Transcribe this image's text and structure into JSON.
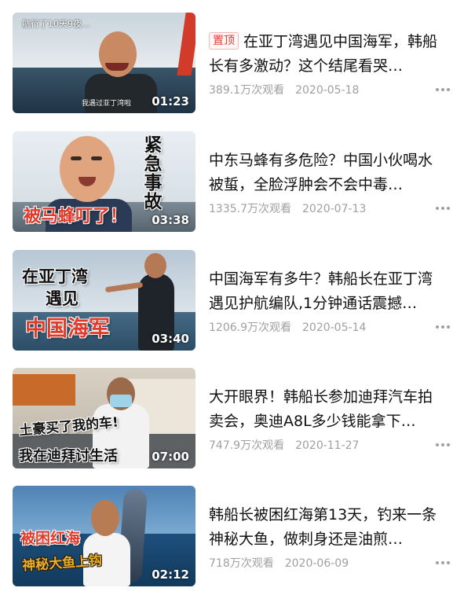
{
  "colors": {
    "pin": "#e33b3b",
    "meta": "#a0a0a0",
    "title": "#111111"
  },
  "videos": [
    {
      "pinned": true,
      "pin_label": "置顶",
      "title": "在亚丁湾遇见中国海军，韩船长有多激动？这个结尾看哭…",
      "views": "389.1万次观看",
      "date": "2020-05-18",
      "duration": "01:23",
      "thumb_top": "航行了10天9夜…",
      "thumb_caption": "我遇过亚丁湾啦"
    },
    {
      "pinned": false,
      "title": "中东马蜂有多危险？中国小伙喝水被蜇，全脸浮肿会不会中毒…",
      "views": "1335.7万次观看",
      "date": "2020-07-13",
      "duration": "03:38",
      "thumb_text_1": "被马蜂叮了！",
      "thumb_text_2": "紧急事故"
    },
    {
      "pinned": false,
      "title": "中国海军有多牛？韩船长在亚丁湾遇见护航编队,1分钟通话震撼…",
      "views": "1206.9万次观看",
      "date": "2020-05-14",
      "duration": "03:40",
      "thumb_text_1": "在亚丁湾",
      "thumb_text_2": "遇见",
      "thumb_text_3": "中国海军"
    },
    {
      "pinned": false,
      "title": "大开眼界！韩船长参加迪拜汽车拍卖会，奥迪A8L多少钱能拿下…",
      "views": "747.9万次观看",
      "date": "2020-11-27",
      "duration": "07:00",
      "thumb_text_1": "土豪买了我的车!",
      "thumb_text_2": "我在迪拜讨生活"
    },
    {
      "pinned": false,
      "title": "韩船长被困红海第13天，钓来一条神秘大鱼，做刺身还是油煎…",
      "views": "718万次观看",
      "date": "2020-06-09",
      "duration": "02:12",
      "thumb_text_1": "被困红海",
      "thumb_text_2": "神秘大鱼上钩"
    }
  ]
}
